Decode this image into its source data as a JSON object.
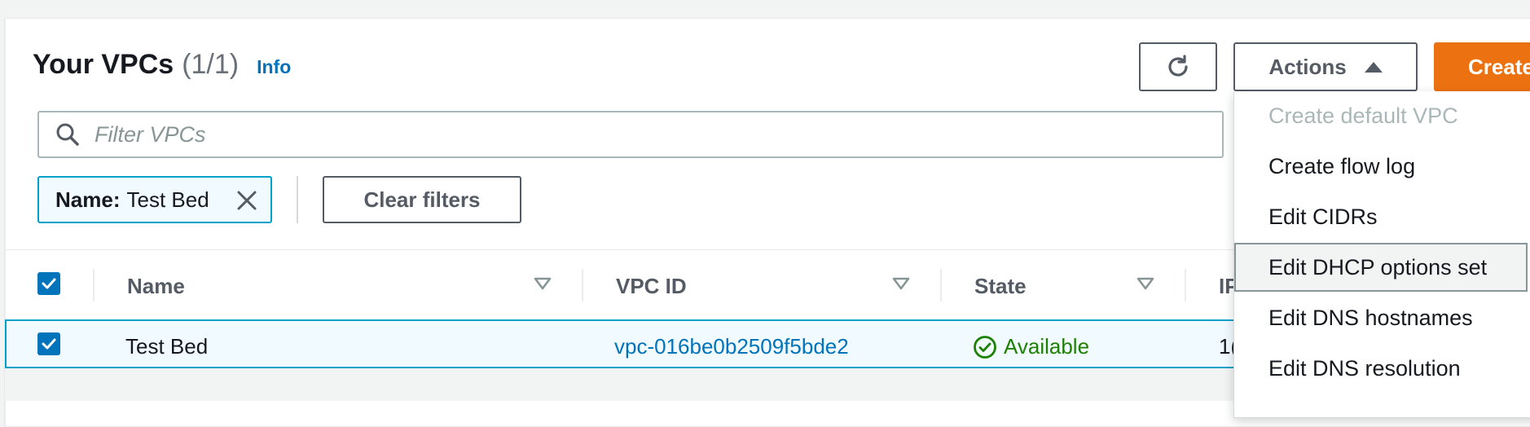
{
  "header": {
    "title": "Your VPCs",
    "count": "(1/1)",
    "info_link": "Info"
  },
  "toolbar": {
    "refresh_icon": "refresh-icon",
    "actions_label": "Actions",
    "create_label": "Create"
  },
  "search": {
    "placeholder": "Filter VPCs",
    "value": ""
  },
  "filter_token": {
    "key": "Name:",
    "value": "Test Bed"
  },
  "clear_filters_label": "Clear filters",
  "table": {
    "columns": [
      "Name",
      "VPC ID",
      "State",
      "IP"
    ],
    "rows": [
      {
        "name": "Test Bed",
        "vpc_id": "vpc-016be0b2509f5bde2",
        "state": "Available",
        "ip": "1("
      }
    ]
  },
  "actions_menu": {
    "items": [
      {
        "label": "Create default VPC",
        "disabled": true
      },
      {
        "label": "Create flow log",
        "disabled": false
      },
      {
        "label": "Edit CIDRs",
        "disabled": false
      },
      {
        "label": "Edit DHCP options set",
        "disabled": false,
        "hovered": true
      },
      {
        "label": "Edit DNS hostnames",
        "disabled": false
      },
      {
        "label": "Edit DNS resolution",
        "disabled": false
      }
    ]
  },
  "colors": {
    "primary_orange": "#ec7211",
    "link_blue": "#0073bb",
    "selected_border": "#00a1c9",
    "status_green": "#1d8102"
  }
}
